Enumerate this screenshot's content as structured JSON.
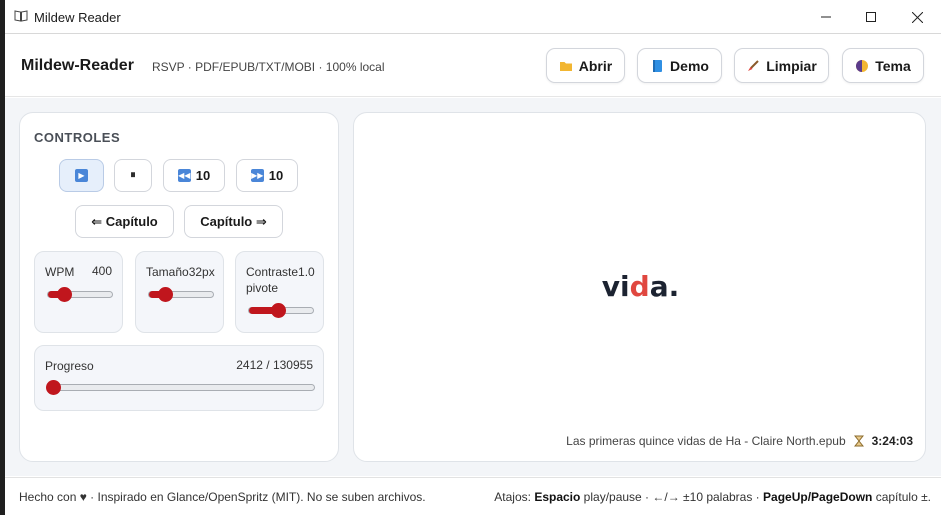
{
  "window": {
    "title": "Mildew Reader"
  },
  "header": {
    "brand": "Mildew-Reader",
    "tagline": "RSVP · PDF/EPUB/TXT/MOBI · 100% local",
    "buttons": {
      "open": "Abrir",
      "demo": "Demo",
      "clear": "Limpiar",
      "theme": "Tema"
    }
  },
  "controls": {
    "title": "CONTROLES",
    "back_label": "10",
    "forward_label": "10",
    "prev_chapter": "⇐ Capítulo",
    "next_chapter": "Capítulo ⇒",
    "wpm": {
      "label": "WPM",
      "value": "400",
      "level": 0.25
    },
    "size": {
      "label": "Tamaño",
      "value": "32px",
      "level": 0.25
    },
    "contrast": {
      "label": "Contraste",
      "value": "1.0",
      "sublabel": "pivote",
      "level": 0.45
    },
    "progress": {
      "label": "Progreso",
      "value": "2412 / 130955",
      "level": 0.018
    }
  },
  "reader": {
    "word_pre": "vi",
    "word_pivot": "d",
    "word_post": "a.",
    "file": "Las primeras quince vidas de Ha - Claire North.epub",
    "time_left": "3:24:03"
  },
  "footer": {
    "left": "Hecho con ♥ · Inspirado en Glance/OpenSpritz (MIT). No se suben archivos.",
    "shortcuts_prefix": "Atajos: ",
    "key_space": "Espacio",
    "space_desc": " play/pause · ←/→ ±10 palabras · ",
    "key_pages": "PageUp/PageDown",
    "pages_desc": " capítulo ±."
  },
  "colors": {
    "accent": "#c0161d",
    "pivot": "#e0473f",
    "play_active_bg": "#e6effb"
  },
  "icons": [
    "book-icon",
    "folder-icon",
    "document-icon",
    "brush-icon",
    "half-moon-icon",
    "play-icon",
    "pause-icon",
    "rewind-icon",
    "fast-forward-icon",
    "hourglass-icon",
    "heart-icon"
  ]
}
